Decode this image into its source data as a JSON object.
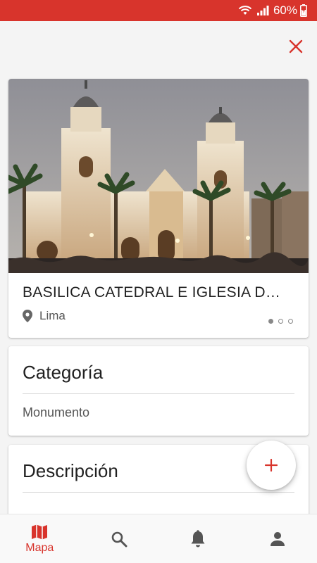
{
  "status_bar": {
    "battery_percent": "60%",
    "icons": [
      "wifi-icon",
      "signal-icon",
      "battery-charging-icon"
    ]
  },
  "colors": {
    "accent": "#d8342c",
    "inactive_icon": "#555555"
  },
  "header": {
    "close_icon": "close-icon"
  },
  "place": {
    "title": "BASILICA CATEDRAL E IGLESIA DEL...",
    "location": "Lima",
    "location_icon": "location-pin-icon",
    "image_description_icon": "photo",
    "pager": {
      "count": 3,
      "active_index": 0
    }
  },
  "category": {
    "title": "Categoría",
    "value": "Monumento"
  },
  "description": {
    "title": "Descripción"
  },
  "fab": {
    "icon": "plus-icon"
  },
  "bottom_nav": {
    "items": [
      {
        "icon": "map-icon",
        "label": "Mapa",
        "active": true
      },
      {
        "icon": "search-icon",
        "label": "",
        "active": false
      },
      {
        "icon": "bell-icon",
        "label": "",
        "active": false
      },
      {
        "icon": "person-icon",
        "label": "",
        "active": false
      }
    ]
  }
}
